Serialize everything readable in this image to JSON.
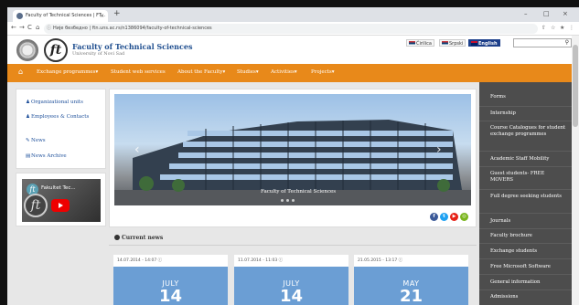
{
  "browser": {
    "tab_title": "Faculty of Technical Sciences | FT...",
    "tab_close": "×",
    "new_tab": "+",
    "window_controls": [
      "–",
      "□",
      "×"
    ],
    "nav_buttons": [
      "←",
      "→",
      "C",
      "⌂"
    ],
    "url_prefix": "Није безбедно",
    "url": "ftn.uns.ac.rs/n1386094/faculty-of-technical-sciences",
    "address_icons": [
      "⇧",
      "☆",
      "★",
      "⋮"
    ]
  },
  "header": {
    "title": "Faculty of Technical Sciences",
    "subtitle": "University of Novi Sad",
    "logo_letter": "ft",
    "languages": [
      {
        "label": "Ćirilica",
        "flag_color": "#c6363c",
        "active": false
      },
      {
        "label": "Srpski",
        "flag_color": "#c6363c",
        "active": false
      },
      {
        "label": "English",
        "flag_color": "#c8102e",
        "active": true
      }
    ],
    "search_icon": "⚲"
  },
  "nav": {
    "home_icon": "⌂",
    "items": [
      "Exchange programmes▾",
      "Student web services",
      "About the Faculty▾",
      "Studies▾",
      "Activities▾",
      "Projects▾"
    ]
  },
  "left_links": [
    {
      "icon": "♟",
      "label": "Organizational units"
    },
    {
      "icon": "♟",
      "label": "Employees & Contacts"
    },
    {
      "icon": "✎",
      "label": "News"
    },
    {
      "icon": "▤",
      "label": "News Archive"
    }
  ],
  "video": {
    "logo_letter": "ft",
    "title": "Fakultet Tec..."
  },
  "hero": {
    "caption": "Faculty of Technical Sciences",
    "arrow_left": "‹",
    "arrow_right": "›",
    "social": [
      {
        "label": "f",
        "color": "#3b5998"
      },
      {
        "label": "t",
        "color": "#1da1f2"
      },
      {
        "label": "▶",
        "color": "#e62117"
      },
      {
        "label": "◎",
        "color": "#7ab51d"
      }
    ]
  },
  "news": {
    "heading": "Current news",
    "cards": [
      {
        "date": "14.07.2014 - 14:07 ⓘ",
        "month": "JULY",
        "day": "14"
      },
      {
        "date": "11.07.2014 - 11:03 ⓘ",
        "month": "JULY",
        "day": "14"
      },
      {
        "date": "21.05.2015 - 13:17 ⓘ",
        "month": "MAY",
        "day": "21"
      }
    ]
  },
  "right_sidebar": {
    "items": [
      "Forms",
      "Internship",
      "Course Catalogues for student exchange programmes",
      "Academic Staff Mobility",
      "Guest students- FREE MOVERS",
      "Full degree seeking students",
      "Journals",
      "Faculty brochure",
      "Exchange students",
      "Free Microsoft Software",
      "General information",
      "Admissions"
    ]
  }
}
